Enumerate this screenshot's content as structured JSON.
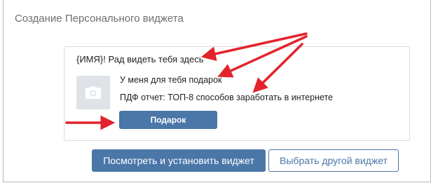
{
  "panel": {
    "title": "Создание Персонального виджета"
  },
  "widget": {
    "greeting": "{ИМЯ}! Рад видеть тебя здесь",
    "line1": "У меня для тебя подарок",
    "line2": "ПДФ отчет: ТОП-8 способов заработать в интернете",
    "button_label": "Подарок",
    "image_icon": "camera-icon"
  },
  "actions": {
    "preview_install_label": "Посмотреть и установить виджет",
    "choose_other_label": "Выбрать другой виджет"
  },
  "colors": {
    "accent": "#4a76a8",
    "annotation_arrow": "#e3232b",
    "placeholder_bg": "#dfe3e8"
  }
}
